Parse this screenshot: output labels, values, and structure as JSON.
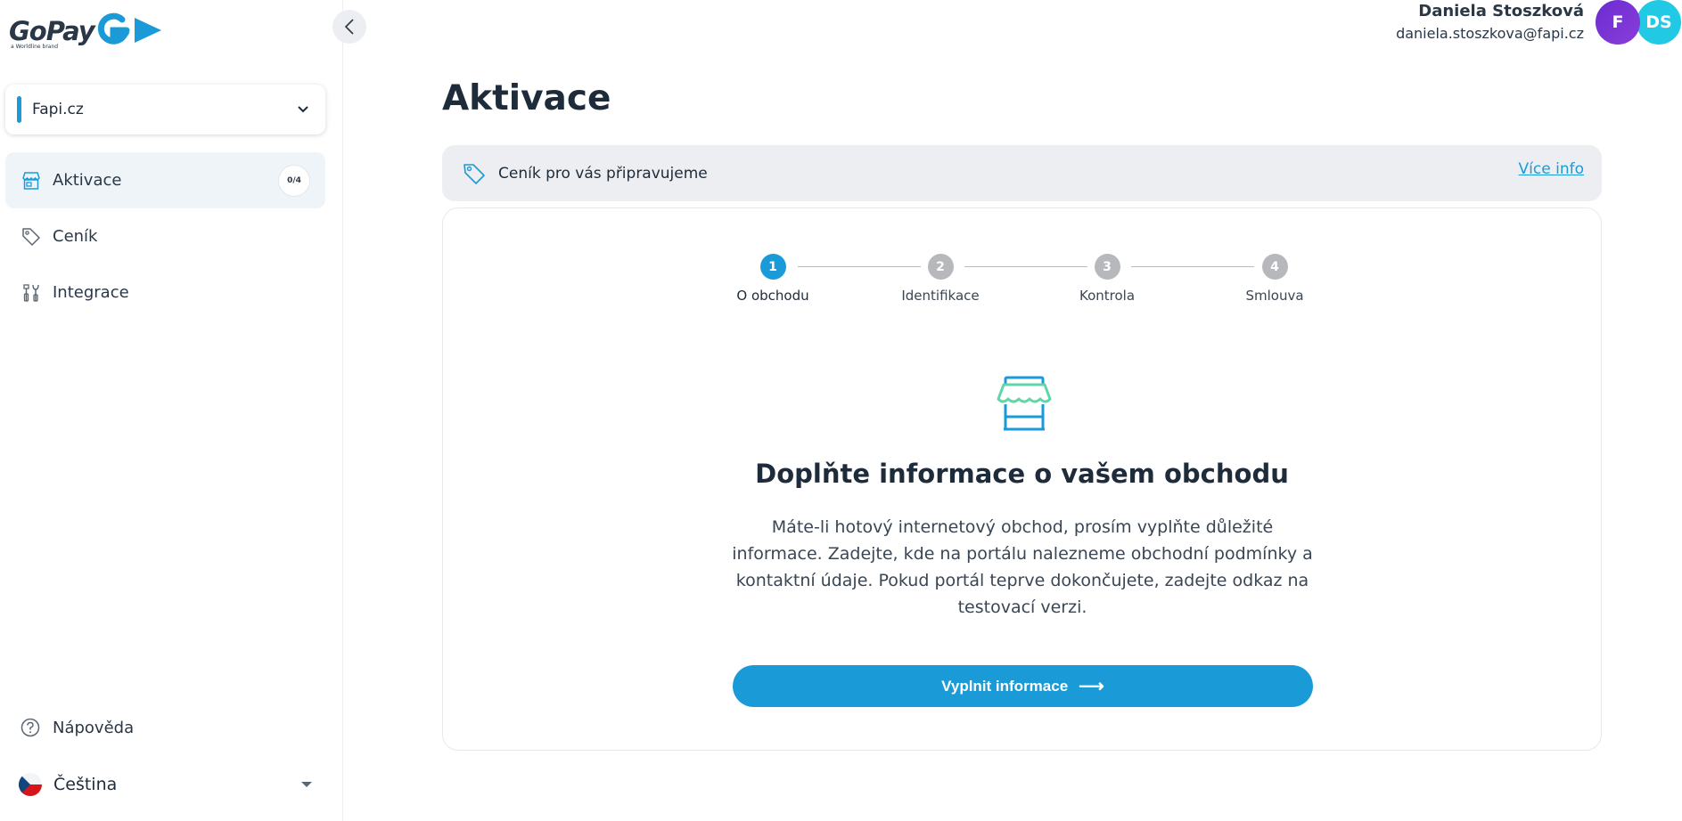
{
  "brand": {
    "name": "GoPay",
    "tagline": "a Worldline brand",
    "accent": "#1a9bd7"
  },
  "shop_selector": {
    "value": "Fapi.cz"
  },
  "sidebar": {
    "items": [
      {
        "label": "Aktivace",
        "badge": "0/4",
        "active": true,
        "icon": "store-icon"
      },
      {
        "label": "Ceník",
        "icon": "tag-icon"
      },
      {
        "label": "Integrace",
        "icon": "tools-icon"
      }
    ],
    "help": {
      "label": "Nápověda",
      "icon": "help-icon"
    },
    "language": {
      "label": "Čeština",
      "icon": "flag-cz-icon"
    }
  },
  "user": {
    "name": "Daniela Stoszková",
    "email": "daniela.stoszkova@fapi.cz",
    "avatars": [
      "F",
      "DS"
    ]
  },
  "main": {
    "title": "Aktivace",
    "banner": {
      "text": "Ceník pro vás připravujeme",
      "link": "Více info"
    },
    "steps": [
      {
        "number": "1",
        "label": "O obchodu",
        "active": true
      },
      {
        "number": "2",
        "label": "Identifikace"
      },
      {
        "number": "3",
        "label": "Kontrola"
      },
      {
        "number": "4",
        "label": "Smlouva"
      }
    ],
    "card": {
      "title": "Doplňte informace o vašem obchodu",
      "description": "Máte-li hotový internetový obchod, prosím vyplňte důležité informace. Zadejte, kde na portálu nalezneme obchodní podmínky a kontaktní údaje. Pokud portál teprve dokončujete, zadejte odkaz na testovací verzi.",
      "button": "Vyplnit informace",
      "button_arrow": "⟶"
    }
  }
}
